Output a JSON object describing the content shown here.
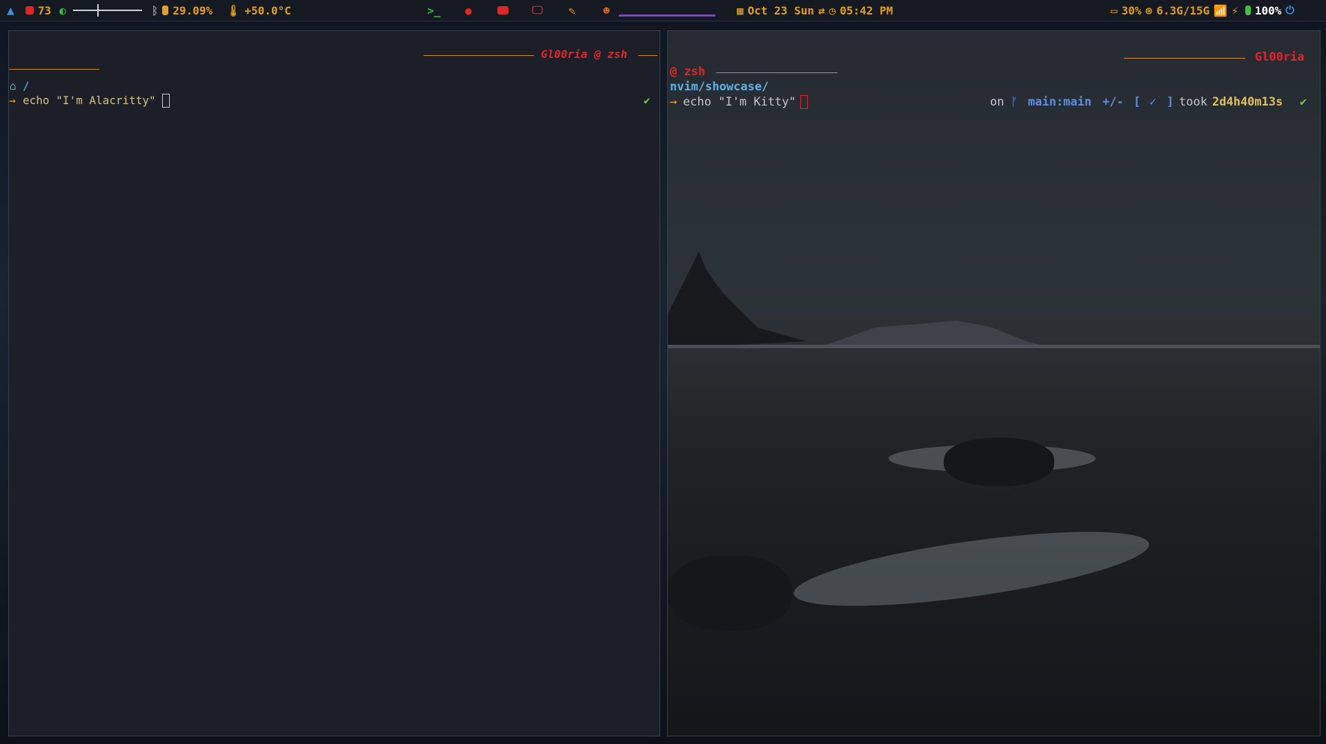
{
  "topbar": {
    "cpu": "73",
    "storage_pct": "29.09%",
    "temperature": "+50.0°C",
    "date": "Oct 23 Sun",
    "time": "05:42 PM",
    "disk": "30%",
    "memory": "6.3G/15G",
    "battery": "100%",
    "volume_level": 0.35
  },
  "left_terminal": {
    "header": "Gl00ria @ zsh",
    "path": "/",
    "command": "echo \"I'm Alacritty\""
  },
  "right_terminal": {
    "header_user": "Gl00ria",
    "header_shell": "@ zsh",
    "path": "nvim/showcase/",
    "command": "echo \"I'm Kitty\"",
    "git_on": "on",
    "git_branch": "main:main",
    "git_changes": "+/-",
    "bracket_open": "[",
    "bracket_close": "]",
    "took": "took",
    "duration": "2d4h40m13s"
  },
  "colors": {
    "accent_orange": "#f0a030",
    "accent_red": "#e0262b",
    "workspace_underline": "#8a3be0"
  }
}
